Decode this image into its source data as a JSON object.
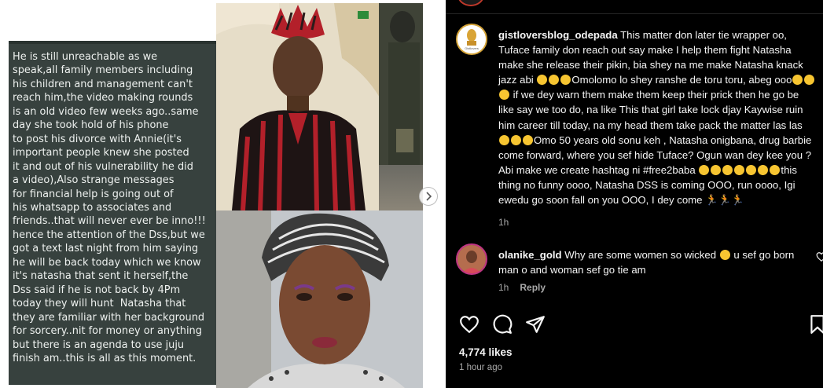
{
  "screenshot_text": {
    "lines": [
      "He is still unreachable as we",
      "speak,all family members including",
      "his children and management can't",
      "reach him,the video making rounds",
      "is an old video few weeks ago..same",
      "day she took hold of his phone",
      "to post his divorce with Annie(it's",
      "important people knew she posted",
      "it and out of his vulnerability he did",
      "a video),Also strange messages",
      "for financial help is going out of",
      "his whatsapp to associates and",
      "friends..that will never ever be inno!!!",
      "hence the attention of the Dss,but we",
      "got a text last night from him saying",
      "he will be back today which we know",
      "it's natasha that sent it herself,the",
      "Dss said if he is not back by 4Pm",
      "today they will hunt  Natasha that",
      "they are familiar with her background",
      "for sorcery..nit for money or anything",
      "but there is an agenda to use juju",
      "finish am..this is all as this moment."
    ]
  },
  "comments": [
    {
      "username": "gistloversblog_odepada",
      "avatar_label": "Gistlovers",
      "text_parts": [
        " This matter don later tie wrapper oo, Tuface family don reach out say make I help them fight Natasha make she release their pikin, bia shey na me make Natasha knack jazz abi",
        "Omolomo lo shey ranshe de toru toru, abeg ooo",
        "if we dey warn them make them keep their prick then he go be like say we too do, na like This that girl take lock djay Kaywise ruin him career till today, na my head them take pack the matter las las",
        "Omo 50 years old sonu keh , Natasha onigbana, drug barbie come forward, where you sef hide Tuface? Ogun wan dey kee you ? Abi make we create hashtag ni #free2baba",
        "this thing no funny oooo, Natasha DSS is coming OOO, run oooo, Igi ewedu go soon fall on you OOO, I dey come"
      ],
      "time": "1h"
    },
    {
      "username": "olanike_gold",
      "text_parts": [
        " Why are some women so wicked",
        " u sef go born man o and woman sef go tie am"
      ],
      "time": "1h",
      "reply_label": "Reply"
    }
  ],
  "post": {
    "likes": "4,774 likes",
    "time": "1 hour ago"
  },
  "icons": {
    "like": "heart-icon",
    "comment": "comment-bubble-icon",
    "share": "send-icon",
    "save": "bookmark-icon",
    "next": "chevron-right-icon"
  },
  "colors": {
    "panel_bg": "#000000",
    "text": "#f5f5f5",
    "muted": "#a8a8a8",
    "chat_bg": "#37413e"
  }
}
